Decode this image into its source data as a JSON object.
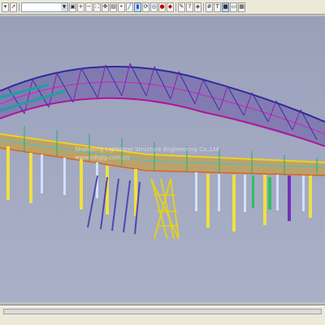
{
  "toolbar": {
    "view_combo_value": "",
    "buttons": [
      {
        "icon": "dropdown-arrow-icon"
      },
      {
        "icon": "cursor-arrow-icon"
      },
      {
        "icon": "zoom-window-icon"
      },
      {
        "icon": "zoom-in-icon"
      },
      {
        "icon": "zoom-out-icon"
      },
      {
        "icon": "zoom-all-icon"
      },
      {
        "icon": "pan-icon"
      },
      {
        "icon": "section-icon"
      },
      {
        "icon": "node-icon"
      },
      {
        "icon": "beam-icon"
      },
      {
        "icon": "load-icon"
      },
      {
        "icon": "rotate-icon"
      },
      {
        "icon": "front-view-icon"
      },
      {
        "icon": "color-icon"
      },
      {
        "icon": "shade-icon"
      },
      {
        "icon": "highlight-icon"
      },
      {
        "icon": "query-icon"
      },
      {
        "icon": "render-icon"
      },
      {
        "icon": "grid-icon"
      },
      {
        "icon": "text-icon"
      },
      {
        "icon": "print-icon"
      },
      {
        "icon": "window-icon"
      }
    ]
  },
  "viewport": {
    "watermark_line1": "Shandong Lightsteel Structure Engineering Co.,Ltd",
    "watermark_line2": "www.sdlgjg.com.cn"
  }
}
